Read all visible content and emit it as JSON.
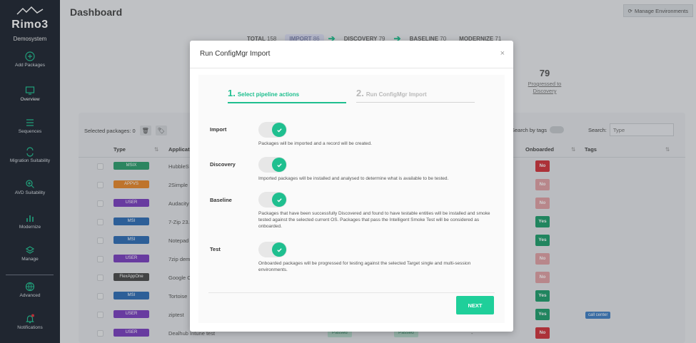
{
  "app": {
    "logo_text": "Rimo3",
    "system_name": "Demosystem"
  },
  "sidebar": {
    "items": [
      {
        "label": "Add Packages",
        "icon": "plus-circle-icon"
      },
      {
        "label": "Overview",
        "icon": "monitor-icon"
      },
      {
        "label": "Sequences",
        "icon": "list-icon"
      },
      {
        "label": "Migration Suitability",
        "icon": "arrows-icon"
      },
      {
        "label": "AVD Suitability",
        "icon": "search-plus-icon"
      },
      {
        "label": "Modernize",
        "icon": "bar-chart-icon"
      },
      {
        "label": "Manage",
        "icon": "layers-icon"
      },
      {
        "label": "Advanced",
        "icon": "globe-icon"
      },
      {
        "label": "Notifications",
        "icon": "bell-icon"
      }
    ]
  },
  "header": {
    "title": "Dashboard",
    "manage_env_label": "Manage Environments"
  },
  "pipeline": {
    "total_label": "TOTAL",
    "total_count": "158",
    "import_label": "IMPORT",
    "import_count": "86",
    "discovery_label": "DISCOVERY",
    "discovery_count": "79",
    "baseline_label": "BASELINE",
    "baseline_count": "70",
    "modernize_label": "MODERNIZE",
    "modernize_count": "71"
  },
  "stat": {
    "value": "79",
    "label": "Progressed to Discovery"
  },
  "table": {
    "selected_label": "Selected packages: 0",
    "search_by_tags_label": "Search by tags",
    "search_label": "Search:",
    "search_placeholder": "Type",
    "columns": {
      "type": "Type",
      "application": "Applicat",
      "onboarded": "Onboarded",
      "tags": "Tags"
    },
    "rows": [
      {
        "type": "MSIX",
        "app": "HubbleS",
        "onboarded": "No"
      },
      {
        "type": "APPVS",
        "app": "2Simple",
        "onboarded": "No"
      },
      {
        "type": "USER",
        "app": "Audacity",
        "onboarded": "No"
      },
      {
        "type": "MSI",
        "app": "7-Zip 23.",
        "onboarded": "Yes"
      },
      {
        "type": "MSI",
        "app": "Notepad",
        "onboarded": "Yes"
      },
      {
        "type": "USER",
        "app": "7zip dem",
        "onboarded": "No"
      },
      {
        "type": "FlexAppOne",
        "app": "Google C",
        "onboarded": "No"
      },
      {
        "type": "MSI",
        "app": "Tortoise",
        "onboarded": "Yes"
      },
      {
        "type": "USER",
        "app": "ziptest",
        "onboarded": "Yes",
        "tag": "call center"
      },
      {
        "type": "USER",
        "app": "Dealhub Intune test",
        "onboarded": "No",
        "passed1": "Passed",
        "passed2": "Passed",
        "dash": "-"
      }
    ]
  },
  "colors": {
    "accent": "#1fbf8f",
    "MSIX": "#2e9e6e",
    "APPVS": "#e8882b",
    "USER": "#7a3fbf",
    "MSI": "#2f6db5",
    "FlexAppOne": "#4a4a4a",
    "yes": "#1f9e6c",
    "no": "#d1343c",
    "no_faded": "#e0a0a4"
  },
  "modal": {
    "title": "Run ConfigMgr Import",
    "close": "×",
    "step1_num": "1.",
    "step1_label": "Select pipeline actions",
    "step2_num": "2.",
    "step2_label": "Run ConfigMgr Import",
    "actions": [
      {
        "label": "Import",
        "enabled": true,
        "desc": "Packages will be imported and a record will be created."
      },
      {
        "label": "Discovery",
        "enabled": true,
        "desc": "Imported packages will be installed and analysed to determine what is available to be tested."
      },
      {
        "label": "Baseline",
        "enabled": true,
        "desc": "Packages that have been successfully Discovered and found to have testable entities will be installed and smoke tested against the selected current OS. Packages that pass the Intelligent Smoke Test will be considered as onboarded."
      },
      {
        "label": "Test",
        "enabled": true,
        "desc": "Onboarded packages will be progressed for testing against the selected Target single and multi-session environments."
      }
    ],
    "next_label": "NEXT"
  }
}
